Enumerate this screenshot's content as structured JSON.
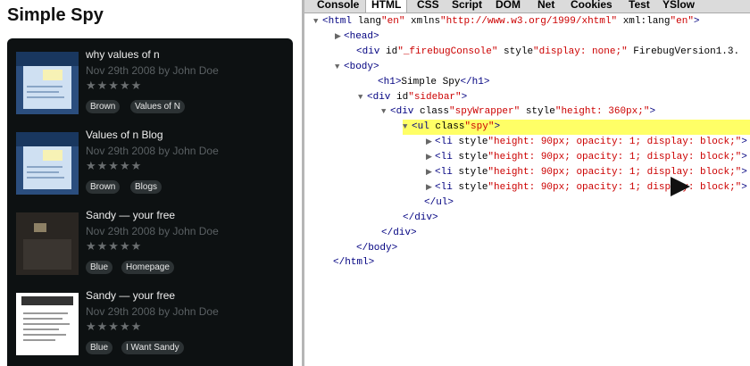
{
  "page": {
    "title": "Simple Spy"
  },
  "spy_items": [
    {
      "title": "why values of n",
      "meta": "Nov 29th 2008 by John Doe",
      "stars": "★★★★★",
      "thumb": "blue",
      "tags": [
        "Brown",
        "Values of N"
      ]
    },
    {
      "title": "Values of n Blog",
      "meta": "Nov 29th 2008 by John Doe",
      "stars": "★★★★★",
      "thumb": "blue",
      "tags": [
        "Brown",
        "Blogs"
      ]
    },
    {
      "title": "Sandy — your free",
      "meta": "Nov 29th 2008 by John Doe",
      "stars": "★★★★★",
      "thumb": "dark",
      "tags": [
        "Blue",
        "Homepage"
      ]
    },
    {
      "title": "Sandy — your free",
      "meta": "Nov 29th 2008 by John Doe",
      "stars": "★★★★★",
      "thumb": "white",
      "tags": [
        "Blue",
        "I Want Sandy"
      ]
    }
  ],
  "firebug": {
    "tabs": [
      "Console",
      "HTML",
      "CSS",
      "Script",
      "DOM",
      "Net",
      "Cookies",
      "Test",
      "YSlow"
    ],
    "active_tab": "HTML",
    "tree": [
      {
        "twisty": "▼",
        "text": "<html lang=\"en\" xmlns=\"http://www.w3.org/1999/xhtml\" xml:lang=\"en\">"
      },
      {
        "twisty": "▶",
        "text": "<head>"
      },
      {
        "twisty": "",
        "text": "<div id=\"_firebugConsole\" style=\"display: none;\" FirebugVersion=\"1.3."
      },
      {
        "twisty": "▼",
        "text": "<body>"
      },
      {
        "twisty": "",
        "text": "<h1>Simple Spy</h1>"
      },
      {
        "twisty": "▼",
        "text": "<div id=\"sidebar\">"
      },
      {
        "twisty": "▼",
        "text": "<div class=\"spyWrapper\" style=\"height: 360px;\">"
      },
      {
        "twisty": "▼",
        "text": "<ul class=\"spy\">"
      },
      {
        "twisty": "▶",
        "text": "<li style=\"height: 90px; opacity: 1; display: block;\">"
      },
      {
        "twisty": "▶",
        "text": "<li style=\"height: 90px; opacity: 1; display: block;\">"
      },
      {
        "twisty": "▶",
        "text": "<li style=\"height: 90px; opacity: 1; display: block;\">"
      },
      {
        "twisty": "▶",
        "text": "<li style=\"height: 90px; opacity: 1; display: block;\">"
      },
      {
        "twisty": "",
        "text": "</ul>"
      },
      {
        "twisty": "",
        "text": "</div>"
      },
      {
        "twisty": "",
        "text": "</div>"
      },
      {
        "twisty": "",
        "text": "</body>"
      },
      {
        "twisty": "",
        "text": "</html>"
      }
    ]
  }
}
